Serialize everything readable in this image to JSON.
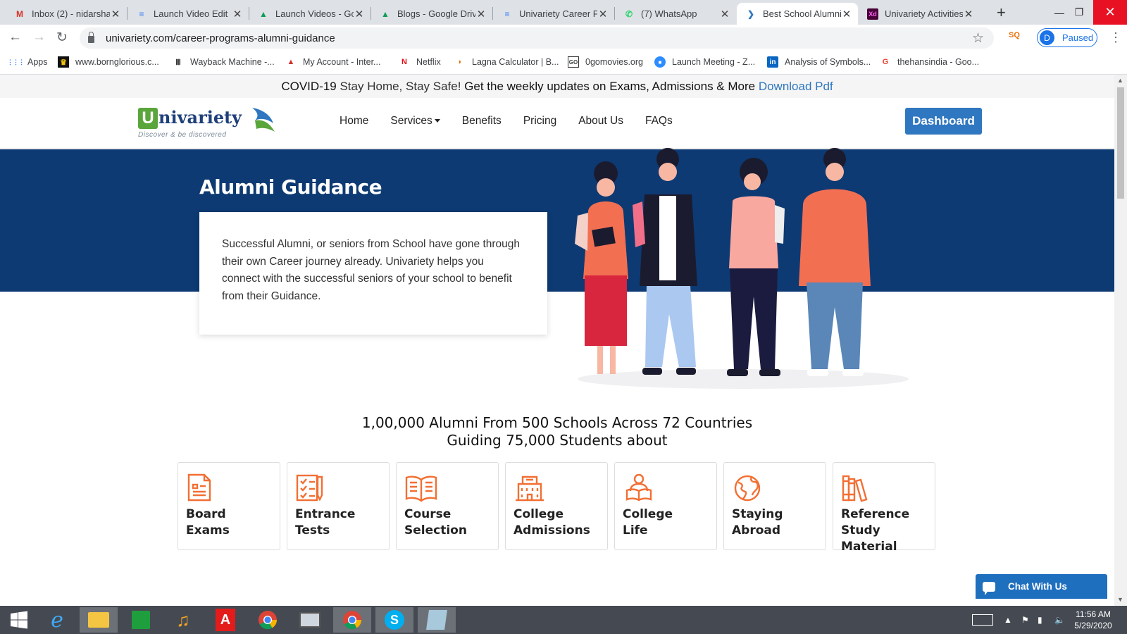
{
  "browser": {
    "tabs": [
      {
        "title": "Inbox (2) - nidarsha",
        "icon": "gmail-icon",
        "color": "#d93025",
        "glyph": "M"
      },
      {
        "title": "Launch Video Edit ",
        "icon": "docs-icon",
        "color": "#4285f4",
        "glyph": "≡"
      },
      {
        "title": "Launch Videos - Go",
        "icon": "drive-icon",
        "color": "#0f9d58",
        "glyph": "▲"
      },
      {
        "title": "Blogs - Google Driv",
        "icon": "drive-icon",
        "color": "#0f9d58",
        "glyph": "▲"
      },
      {
        "title": "Univariety Career P",
        "icon": "docs-icon",
        "color": "#4285f4",
        "glyph": "≡"
      },
      {
        "title": "(7) WhatsApp",
        "icon": "whatsapp-icon",
        "color": "#25d366",
        "glyph": "✆"
      },
      {
        "title": "Best School Alumni",
        "icon": "univariety-icon",
        "color": "#2f77c0",
        "glyph": "❯",
        "active": true
      },
      {
        "title": "Univariety Activities",
        "icon": "xd-icon",
        "color": "#470137",
        "glyph": "Xd"
      }
    ],
    "url": "univariety.com/career-programs-alumni-guidance",
    "profile": {
      "initial": "D",
      "status": "Paused"
    },
    "bookmarks": [
      {
        "label": "Apps",
        "icon": "apps-icon",
        "color": "#4285f4",
        "glyph": "⋮⋮"
      },
      {
        "label": "www.bornglorious.c...",
        "icon": "bornglorious-icon",
        "color": "#c9a100",
        "glyph": "♛"
      },
      {
        "label": "Wayback Machine -...",
        "icon": "wayback-icon",
        "color": "#222",
        "glyph": "Ⅲ"
      },
      {
        "label": "My Account - Inter...",
        "icon": "account-icon",
        "color": "#d32f2f",
        "glyph": "▲"
      },
      {
        "label": "Netflix",
        "icon": "netflix-icon",
        "color": "#e50914",
        "glyph": "N"
      },
      {
        "label": "Lagna Calculator | B...",
        "icon": "lagna-icon",
        "color": "#e8710a",
        "glyph": "◗"
      },
      {
        "label": "0gomovies.org",
        "icon": "gomovies-icon",
        "color": "#333",
        "glyph": "GO"
      },
      {
        "label": "Launch Meeting - Z...",
        "icon": "zoom-icon",
        "color": "#2d8cff",
        "glyph": "■"
      },
      {
        "label": "Analysis of Symbols...",
        "icon": "linkedin-icon",
        "color": "#0a66c2",
        "glyph": "in"
      },
      {
        "label": "thehansindia - Goo...",
        "icon": "google-icon",
        "color": "#ea4335",
        "glyph": "G"
      }
    ]
  },
  "site": {
    "banner": {
      "covid": "COVID-19",
      "stay": " Stay Home, Stay Safe! ",
      "updates": "Get the weekly updates on Exams, Admissions & More ",
      "link": "Download Pdf"
    },
    "logo": {
      "letter": "U",
      "word": "nivariety",
      "tagline": "Discover & be discovered"
    },
    "nav": [
      "Home",
      "Services",
      "Benefits",
      "Pricing",
      "About Us",
      "FAQs"
    ],
    "dashboard": "Dashboard",
    "hero": {
      "title": "Alumni Guidance",
      "body": "Successful Alumni, or seniors from School have gone through their own Career journey already. Univariety helps you connect with the successful seniors of your school to benefit from their Guidance."
    },
    "stats": {
      "line1": "1,00,000 Alumni From 500 Schools Across 72 Countries",
      "line2": "Guiding 75,000 Students about"
    },
    "features": [
      {
        "line1": "Board",
        "line2": "Exams",
        "icon": "board-exams-icon"
      },
      {
        "line1": "Entrance",
        "line2": "Tests",
        "icon": "entrance-tests-icon"
      },
      {
        "line1": "Course",
        "line2": "Selection",
        "icon": "course-selection-icon"
      },
      {
        "line1": "College",
        "line2": "Admissions",
        "icon": "college-admissions-icon"
      },
      {
        "line1": "College",
        "line2": "Life",
        "icon": "college-life-icon"
      },
      {
        "line1": "Staying",
        "line2": "Abroad",
        "icon": "staying-abroad-icon"
      },
      {
        "line1": "Reference",
        "line2": "Study Material",
        "icon": "reference-material-icon"
      }
    ],
    "chat": "Chat With Us",
    "accent": "#f26f33",
    "hero_color": "#0d3a73"
  },
  "taskbar": {
    "time": "11:56 AM",
    "date": "5/29/2020"
  }
}
